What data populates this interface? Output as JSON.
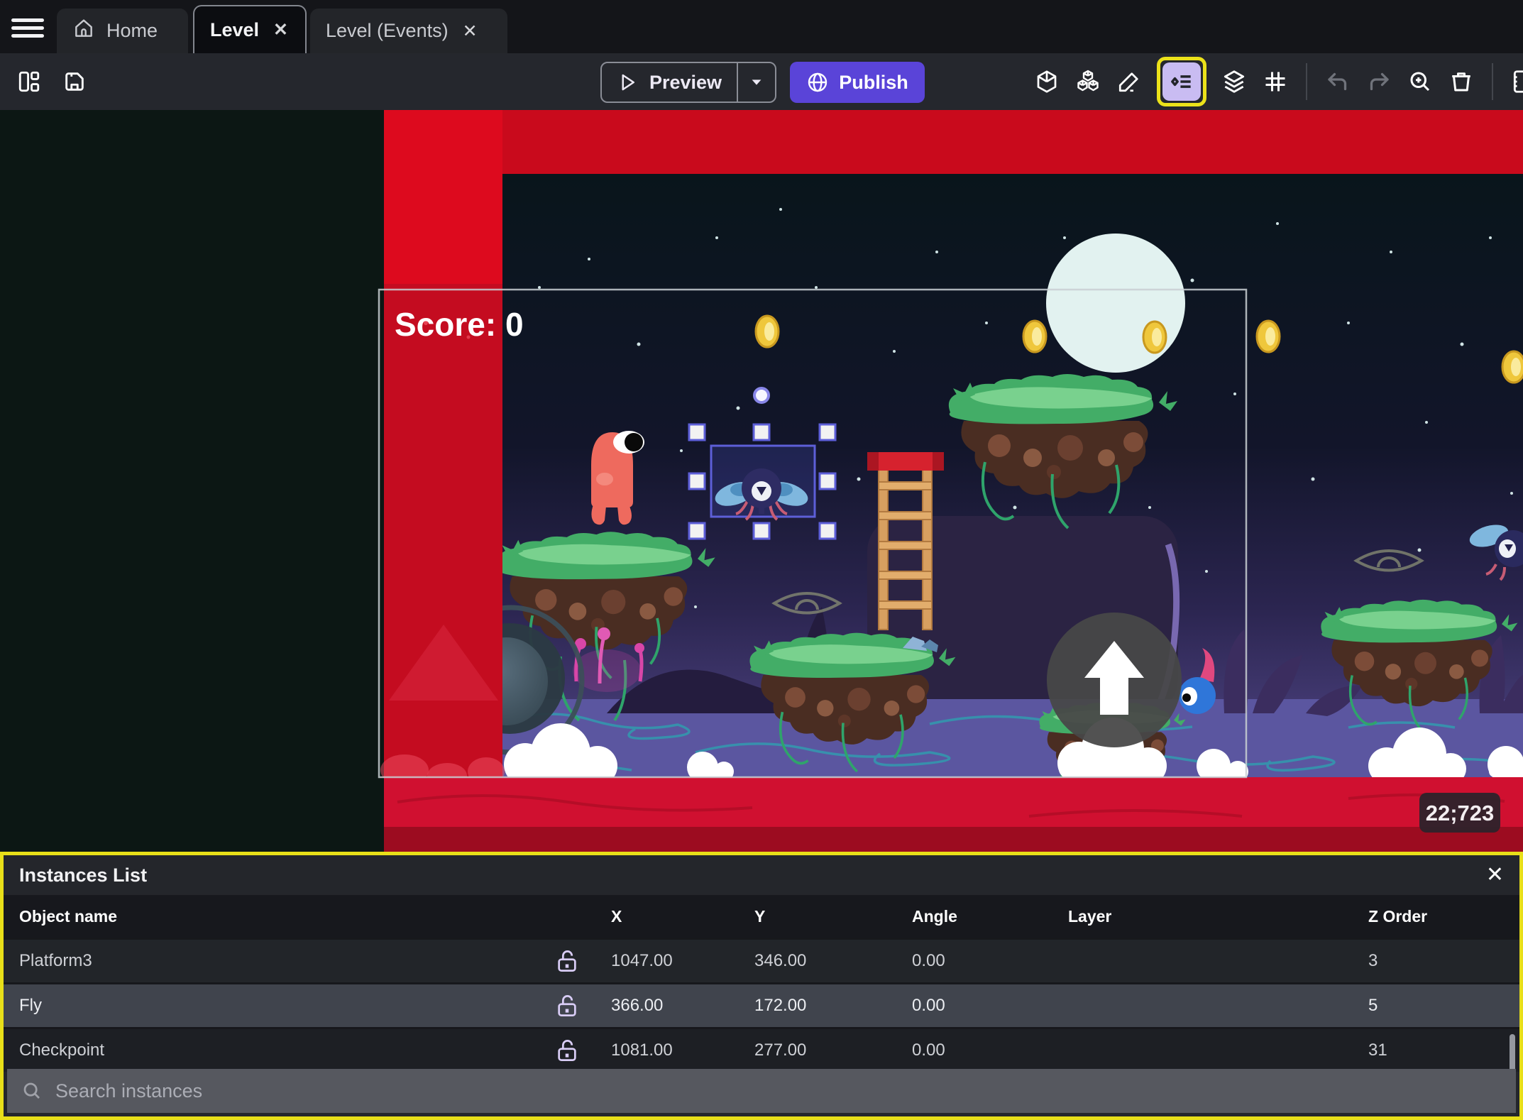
{
  "tabs": {
    "home_label": "Home",
    "level_label": "Level",
    "level_events_label": "Level (Events)"
  },
  "icons": {
    "close": "✕"
  },
  "toolbar": {
    "preview_label": "Preview",
    "publish_label": "Publish"
  },
  "canvas": {
    "score_text": "Score: 0",
    "coords_badge": "22;723"
  },
  "panel": {
    "title": "Instances List",
    "columns": [
      "Object name",
      "X",
      "Y",
      "Angle",
      "Layer",
      "Z Order"
    ],
    "rows": [
      {
        "name": "Platform3",
        "x": "1047.00",
        "y": "346.00",
        "angle": "0.00",
        "layer": "",
        "z_order": "3"
      },
      {
        "name": "Fly",
        "x": "366.00",
        "y": "172.00",
        "angle": "0.00",
        "layer": "",
        "z_order": "5"
      },
      {
        "name": "Checkpoint",
        "x": "1081.00",
        "y": "277.00",
        "angle": "0.00",
        "layer": "",
        "z_order": "31"
      }
    ],
    "search_placeholder": "Search instances"
  },
  "colors": {
    "accent_purple": "#5a44d8",
    "highlight_yellow": "#e8df19",
    "selected_icon_bg": "#c9bcf2",
    "selection_blue": "#5d5fd8",
    "danger_zone_red": "#d40b20",
    "selected_row_bg": "#40444d"
  }
}
